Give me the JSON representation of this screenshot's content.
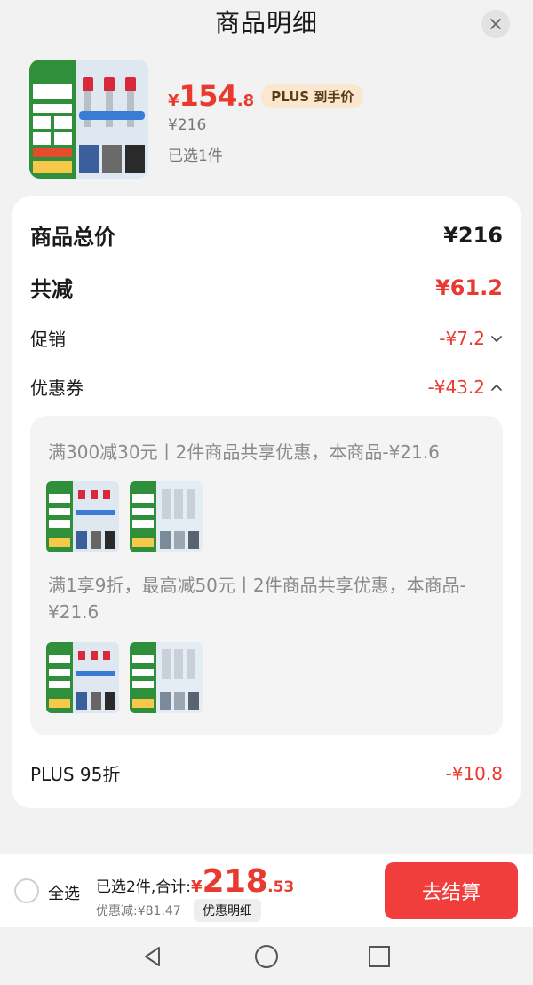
{
  "header": {
    "title": "商品明细"
  },
  "product": {
    "price_symbol": "¥",
    "price_int": "154",
    "price_dec": ".8",
    "plus_tag": "PLUS 到手价",
    "original_price": "¥216",
    "selected_count": "已选1件"
  },
  "details": {
    "total": {
      "label": "商品总价",
      "value": "¥216"
    },
    "reduced": {
      "label": "共减",
      "value": "¥61.2"
    },
    "promo": {
      "label": "促销",
      "value": "-¥7.2"
    },
    "coupon": {
      "label": "优惠券",
      "value": "-¥43.2"
    },
    "coupon_rules": [
      {
        "text": "满300减30元丨2件商品共享优惠，本商品-¥21.6"
      },
      {
        "text": "满1享9折，最高减50元丨2件商品共享优惠，本商品-¥21.6"
      }
    ],
    "plus": {
      "label": "PLUS 95折",
      "value": "-¥10.8"
    }
  },
  "bottom": {
    "select_all": "全选",
    "summary_label": "已选2件,合计:",
    "total_symbol": "¥",
    "total_int": "218",
    "total_dec": ".53",
    "discount_text": "优惠减:¥81.47",
    "detail_button": "优惠明细",
    "checkout": "去结算"
  },
  "colors": {
    "accent": "#e93a2f",
    "checkout": "#f23d3d",
    "plus_bg": "#fbe7cf"
  },
  "icons": [
    "close-icon",
    "chevron-down-icon",
    "chevron-up-icon",
    "back-icon",
    "home-icon",
    "recents-icon"
  ]
}
